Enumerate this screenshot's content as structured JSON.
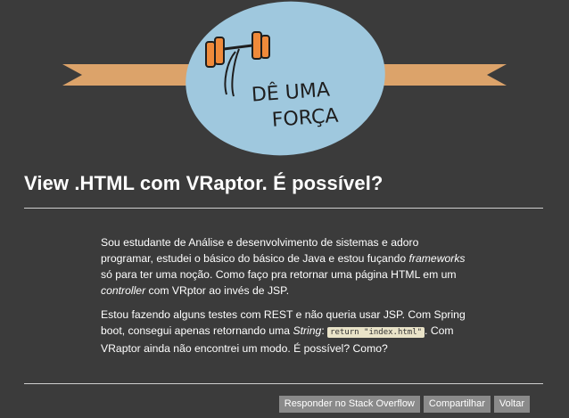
{
  "logo": {
    "line1": "DÊ UMA",
    "line2": "FORÇA"
  },
  "question": {
    "title": "View .HTML com VRaptor. É possível?",
    "p1": [
      "Sou estudante de Análise e desenvolvimento de sistemas e adoro programar, estudei o básico do básico de Java e estou fuçando ",
      "frameworks",
      " só para ter uma noção. Como faço pra retornar uma página HTML em um ",
      "controller",
      " com VRptor ao invés de JSP."
    ],
    "p2": [
      "Estou fazendo alguns testes com REST e não queria usar JSP. Com Spring boot, consegui apenas retornando uma ",
      "String",
      ": ",
      "return \"index.html\"",
      ". Com VRaptor ainda não encontrei um modo. É possível? Como?"
    ]
  },
  "actions": {
    "answer_label": "Responder no Stack Overflow",
    "share_label": "Compartilhar",
    "back_label": "Voltar"
  }
}
